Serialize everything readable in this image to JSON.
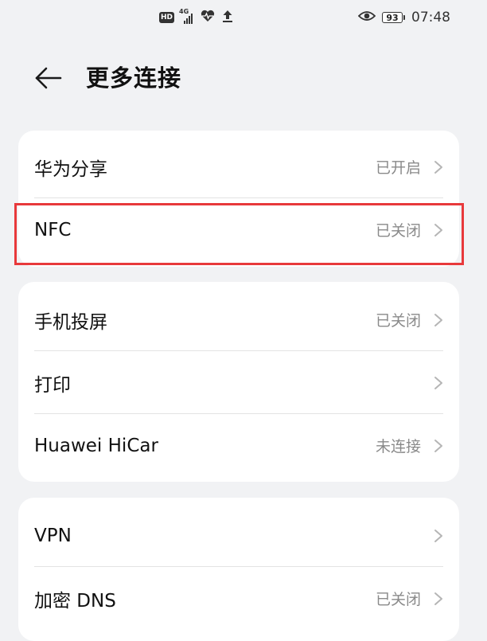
{
  "status_bar": {
    "hd": "HD",
    "network": "4G",
    "battery": "93",
    "time": "07:48"
  },
  "header": {
    "title": "更多连接"
  },
  "groups": [
    {
      "items": [
        {
          "label": "华为分享",
          "value": "已开启"
        },
        {
          "label": "NFC",
          "value": "已关闭"
        }
      ]
    },
    {
      "items": [
        {
          "label": "手机投屏",
          "value": "已关闭"
        },
        {
          "label": "打印",
          "value": ""
        },
        {
          "label": "Huawei HiCar",
          "value": "未连接"
        }
      ]
    },
    {
      "items": [
        {
          "label": "VPN",
          "value": ""
        },
        {
          "label": "加密 DNS",
          "value": "已关闭"
        }
      ]
    }
  ],
  "colors": {
    "background": "#f1f2f4",
    "highlight": "#e8393b",
    "secondary_text": "#8a8a8a"
  }
}
